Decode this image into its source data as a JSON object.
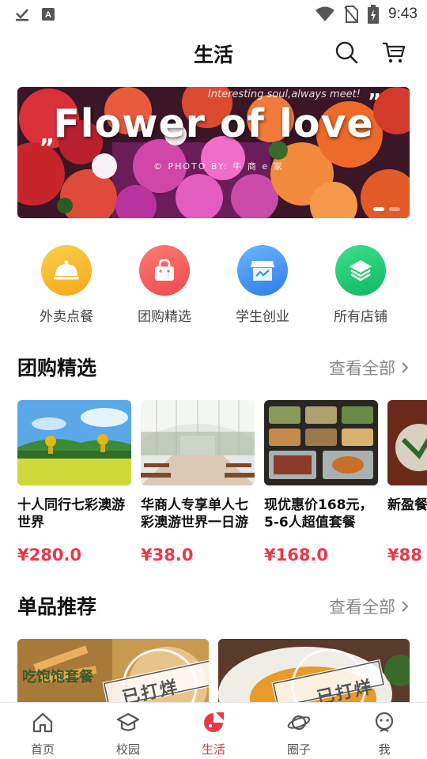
{
  "status_bar": {
    "time": "9:43"
  },
  "header": {
    "title": "生活"
  },
  "banner": {
    "title": "Flower of love",
    "subtitle": "Interesting soul,always meet!",
    "credit": "© PHOTO BY: 牛 商 e 家",
    "quote_open": "„",
    "quote_close": "”",
    "slide_count": 2,
    "active_slide": 1
  },
  "categories": [
    {
      "label": "外卖点餐",
      "icon": "cloche-icon",
      "color": "#f7b320"
    },
    {
      "label": "团购精选",
      "icon": "shopping-bag-icon",
      "color": "#f5605e"
    },
    {
      "label": "学生创业",
      "icon": "storefront-icon",
      "color": "#3b8ff0"
    },
    {
      "label": "所有店铺",
      "icon": "layers-icon",
      "color": "#17c970"
    }
  ],
  "group_section": {
    "title": "团购精选",
    "more": "查看全部"
  },
  "group_items": [
    {
      "title": "十人同行七彩澳游世界",
      "price": "¥280.0"
    },
    {
      "title": "华商人专享单人七彩澳游世界一日游",
      "price": "¥38.0"
    },
    {
      "title": "现优惠价168元，5-6人超值套餐",
      "price": "¥168.0"
    },
    {
      "title": "新盈餐原",
      "price": "¥88"
    }
  ],
  "single_section": {
    "title": "单品推荐",
    "more": "查看全部"
  },
  "single_items": [
    {
      "stamp": "已打烊",
      "caption": "吃饱饱套餐"
    },
    {
      "stamp": "已打烊",
      "caption": ""
    }
  ],
  "bottom_nav": [
    {
      "label": "首页",
      "icon": "home-icon",
      "active": false
    },
    {
      "label": "校园",
      "icon": "graduation-cap-icon",
      "active": false
    },
    {
      "label": "生活",
      "icon": "life-icon",
      "active": true
    },
    {
      "label": "圈子",
      "icon": "planet-icon",
      "active": false
    },
    {
      "label": "我",
      "icon": "profile-icon",
      "active": false
    }
  ],
  "colors": {
    "accent": "#e8394a",
    "price": "#e8394a",
    "muted": "#888888"
  }
}
